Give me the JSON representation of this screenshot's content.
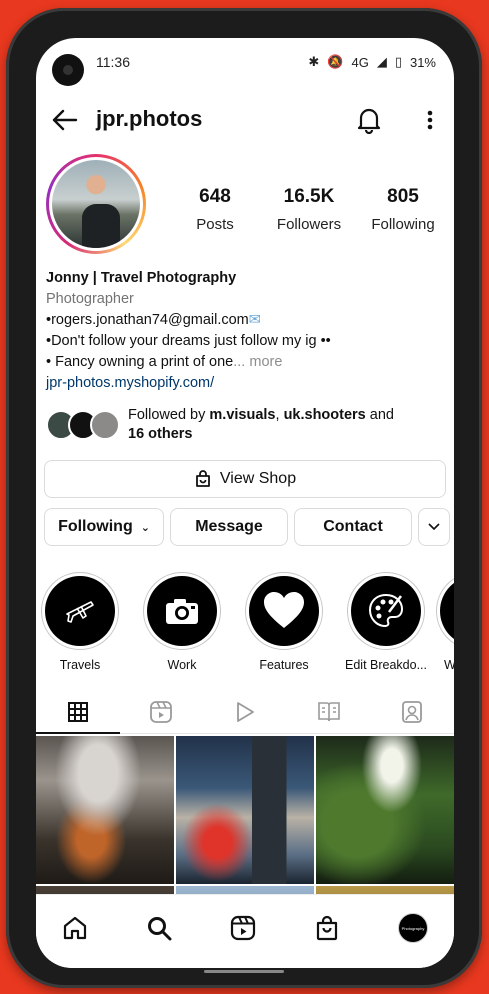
{
  "status_bar": {
    "time": "11:36",
    "network": "4G",
    "battery": "31%"
  },
  "header": {
    "username": "jpr.photos"
  },
  "profile": {
    "posts_count": "648",
    "posts_label": "Posts",
    "followers_count": "16.5K",
    "followers_label": "Followers",
    "following_count": "805",
    "following_label": "Following"
  },
  "bio": {
    "name": "Jonny | Travel Photography",
    "category": "Photographer",
    "line1": "•rogers.jonathan74@gmail.com",
    "line2": "•Don't follow your dreams just follow my ig",
    "line3": "• Fancy owning a print of one",
    "more": "... more",
    "link": "jpr-photos.myshopify.com/"
  },
  "followed_by": {
    "prefix": "Followed by ",
    "user1": "m.visuals",
    "sep": ", ",
    "user2": "uk.shooters",
    "suffix": " and",
    "others": "16 others"
  },
  "actions": {
    "view_shop": "View Shop",
    "following": "Following",
    "message": "Message",
    "contact": "Contact"
  },
  "highlights": [
    {
      "label": "Travels",
      "icon": "airplane-icon"
    },
    {
      "label": "Work",
      "icon": "camera-icon"
    },
    {
      "label": "Features",
      "icon": "heart-icon"
    },
    {
      "label": "Edit Breakdo...",
      "icon": "palette-icon"
    },
    {
      "label": "Wal",
      "icon": "book-icon"
    }
  ],
  "tabs": [
    "grid-icon",
    "reels-icon",
    "video-icon",
    "guides-icon",
    "tagged-icon"
  ],
  "bottom_nav": {
    "avatar_text": "Photography"
  },
  "colors": {
    "background": "#e8381f",
    "link": "#00376b",
    "accent_ring": "#e5306c"
  }
}
